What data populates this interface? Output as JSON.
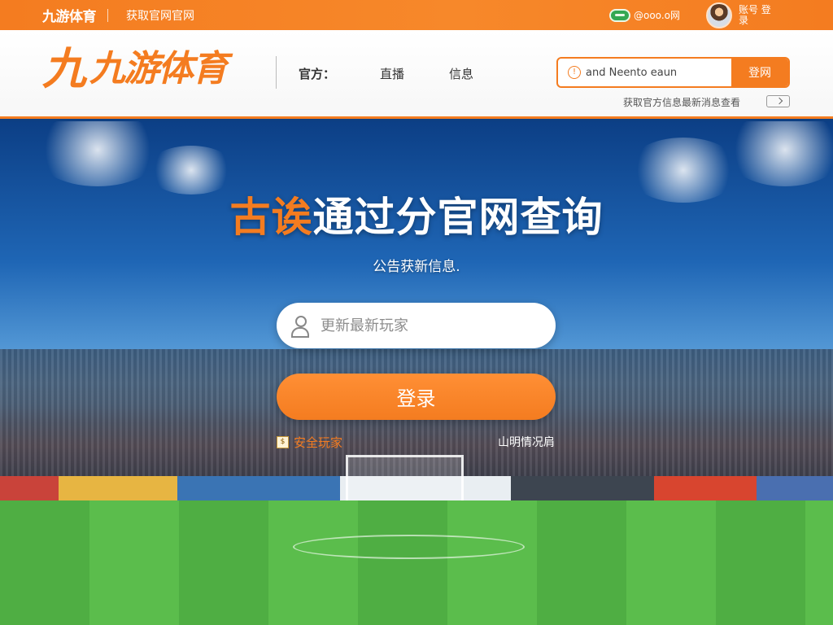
{
  "topbar": {
    "mini_logo": "九游体育",
    "tagline": "获取官网官网",
    "domain_text": "@ooo.o网",
    "user_text": "账号 登录"
  },
  "header": {
    "logo_mark": "九",
    "logo_text": "九游体育",
    "nav": [
      "官方：",
      "直播",
      "信息"
    ],
    "search_placeholder": "and Neento eaun",
    "search_button": "登网",
    "notice": "获取官方信息最新消息查看"
  },
  "hero": {
    "title_accent": "古诶",
    "title_main": "通过分官网查询",
    "subtitle": "公告获新信息.",
    "input_placeholder": "更新最新玩家",
    "login_button": "登录",
    "safe_link": "安全玩家",
    "help_link": "山明情况肩"
  },
  "colors": {
    "brand_orange": "#f47c20",
    "sky_blue": "#1f66b5",
    "pitch_green": "#4fae43"
  },
  "icons": {
    "pill_icon": "green-toggle-icon",
    "info_icon": "info-circle-icon",
    "user_icon": "user-icon",
    "shield_icon": "safe-badge-icon",
    "chevron_icon": "chevron-down-icon"
  }
}
